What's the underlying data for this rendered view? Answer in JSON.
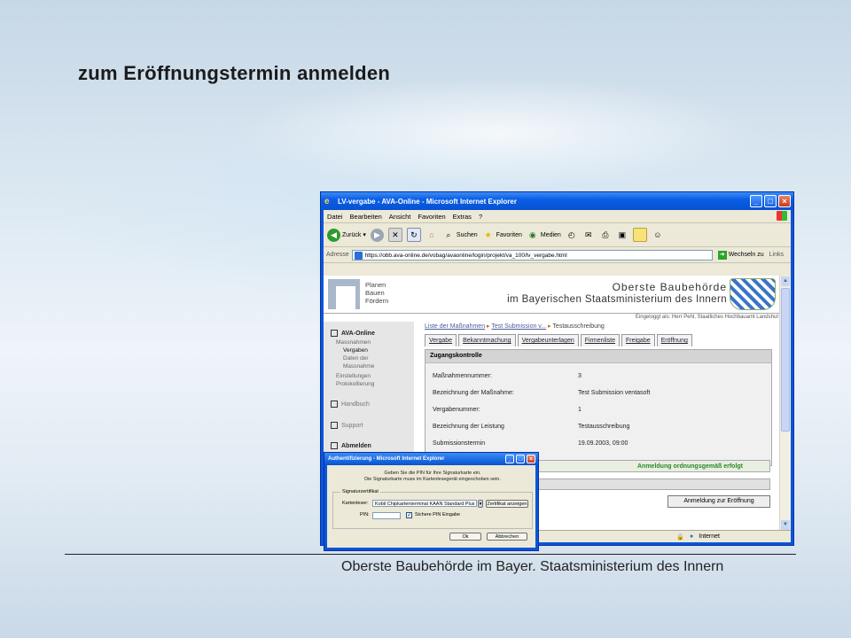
{
  "slide": {
    "title": "zum Eröffnungstermin anmelden",
    "footer": "Oberste Baubehörde im Bayer. Staatsministerium des Innern"
  },
  "browser": {
    "window_title": "LV-vergabe - AVA-Online - Microsoft Internet Explorer",
    "menu": [
      "Datei",
      "Bearbeiten",
      "Ansicht",
      "Favoriten",
      "Extras",
      "?"
    ],
    "toolbar": {
      "back": "Zurück",
      "search": "Suchen",
      "favorites": "Favoriten",
      "media": "Medien"
    },
    "address_label": "Adresse",
    "address_url": "https://obb.ava-online.de/vobag/avaonline/login/projekt/va_100/lv_vergabe.html",
    "go_label": "Wechseln zu",
    "links_label": "Links",
    "status_zone": "Internet"
  },
  "page": {
    "logo_lines": [
      "Planen",
      "Bauen",
      "Fördern"
    ],
    "org_line1": "Oberste Baubehörde",
    "org_line2": "im Bayerischen Staatsministerium des Innern",
    "logged_in": "Eingeloggt als: Herr Pehl, Staatliches Hochbauamt Landshut",
    "nav": {
      "ava_online": "AVA-Online",
      "massnahmen": "Massnahmen",
      "vergaben": "Vergaben",
      "daten_der": "Daten der",
      "massnahme": "Massnahme",
      "einstellungen": "Einstellungen",
      "protokollierung": "Protokollierung",
      "handbuch": "Handbuch",
      "support": "Support",
      "abmelden": "Abmelden"
    },
    "breadcrumb": [
      "Liste der Maßnahmen",
      "Test Submission v...",
      "Testausschreibung"
    ],
    "tabs": [
      "Vergabe",
      "Bekanntmachung",
      "Vergabeunterlagen",
      "Firmenliste",
      "Freigabe",
      "Eröffnung"
    ],
    "panel_title": "Zugangskontrolle",
    "fields": [
      {
        "label": "Maßnahmennummer:",
        "value": "3"
      },
      {
        "label": "Bezeichnung der Maßnahme:",
        "value": "Test Submission ventasoft"
      },
      {
        "label": "Vergabenummer:",
        "value": "1"
      },
      {
        "label": "Bezeichnung der Leistung",
        "value": "Testausschreibung"
      },
      {
        "label": "Submissionstermin",
        "value": "19.09.2003, 09:00"
      }
    ],
    "status_message": "Anmeldung ordnungsgemäß erfolgt",
    "open_button": "Anmeldung zur Eröffnung"
  },
  "dialog": {
    "title": "Authentifizierung - Microsoft Internet Explorer",
    "message_line1": "Geben Sie die PIN für Ihre Signaturkarte ein.",
    "message_line2": "Die Signaturkarte muss im Kartenlesegerät eingeschoben sein.",
    "group_label": "Signaturzertifikat",
    "reader_label": "Kartenleser:",
    "reader_value": "Kobil Chipkartenterminal KAAN Standard Plus",
    "cert_button": "Zertifikat anzeigen",
    "pin_label": "PIN:",
    "secure_pin_label": "Sichere PIN Eingabe",
    "ok_button": "Ok",
    "cancel_button": "Abbrechen"
  },
  "colors": {
    "xp_blue": "#0a56d8",
    "success_green": "#2a8a2a"
  }
}
